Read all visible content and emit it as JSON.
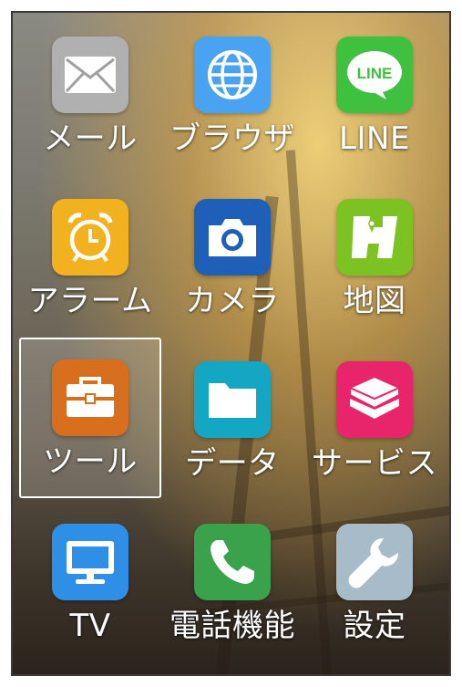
{
  "apps": [
    {
      "label": "メール",
      "icon": "mail-icon",
      "color": "#a9a9a9"
    },
    {
      "label": "ブラウザ",
      "icon": "globe-icon",
      "color": "#4aa3f0"
    },
    {
      "label": "LINE",
      "icon": "line-icon",
      "color": "#3fc13f",
      "badge_text": "LINE"
    },
    {
      "label": "アラーム",
      "icon": "alarm-clock-icon",
      "color": "#f2b21f"
    },
    {
      "label": "カメラ",
      "icon": "camera-icon",
      "color": "#1e5fb8"
    },
    {
      "label": "地図",
      "icon": "map-icon",
      "color": "#7cc222"
    },
    {
      "label": "ツール",
      "icon": "toolbox-icon",
      "color": "#d86f1e",
      "selected": true
    },
    {
      "label": "データ",
      "icon": "folder-icon",
      "color": "#14a7c4"
    },
    {
      "label": "サービス",
      "icon": "layers-icon",
      "color": "#e8246b"
    },
    {
      "label": "TV",
      "icon": "tv-icon",
      "color": "#2f8fe6"
    },
    {
      "label": "電話機能",
      "icon": "phone-icon",
      "color": "#3aa24a"
    },
    {
      "label": "設定",
      "icon": "wrench-icon",
      "color": "#a7bcc8"
    }
  ]
}
